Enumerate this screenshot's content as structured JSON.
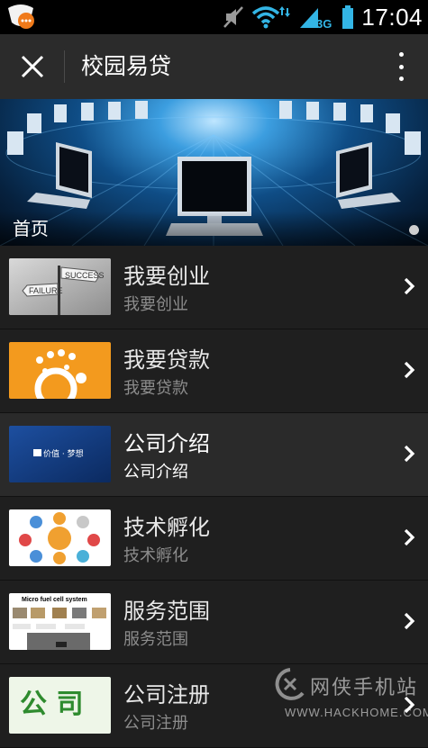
{
  "status_bar": {
    "time": "17:04",
    "network": "3G",
    "icons": [
      "app-notification-icon",
      "mute-icon",
      "wifi-icon",
      "signal-icon",
      "battery-icon"
    ]
  },
  "title_bar": {
    "title": "校园易贷",
    "close_icon": "close-icon",
    "more_icon": "more-vert-icon"
  },
  "banner": {
    "caption": "首页",
    "slide_count": 1,
    "active_slide": 1
  },
  "list": [
    {
      "title": "我要创业",
      "subtitle": "我要创业",
      "thumb": "success-failure-signpost",
      "active": false
    },
    {
      "title": "我要贷款",
      "subtitle": "我要贷款",
      "thumb": "orange-coins",
      "active": false
    },
    {
      "title": "公司介绍",
      "subtitle": "公司介绍",
      "thumb": "blue-banner",
      "active": true,
      "thumb_text": "价值 · 梦想"
    },
    {
      "title": "技术孵化",
      "subtitle": "技术孵化",
      "thumb": "coin-icons-grid",
      "active": false
    },
    {
      "title": "服务范围",
      "subtitle": "服务范围",
      "thumb": "fuel-cell-diagram",
      "active": false,
      "thumb_text": "Micro fuel cell system"
    },
    {
      "title": "公司注册",
      "subtitle": "公司注册",
      "thumb": "company-text-green",
      "active": false,
      "thumb_text": "公 司"
    }
  ],
  "watermark": {
    "text": "网侠手机站",
    "url": "WWW.HACKHOME.COM"
  },
  "colors": {
    "status_bar_bg": "#000000",
    "title_bar_bg": "#2b2b2b",
    "list_bg": "#1f1f1f",
    "active_row_bg": "#2a2a2a",
    "battery": "#33b5e5",
    "orange_thumb": "#f39a1e"
  }
}
